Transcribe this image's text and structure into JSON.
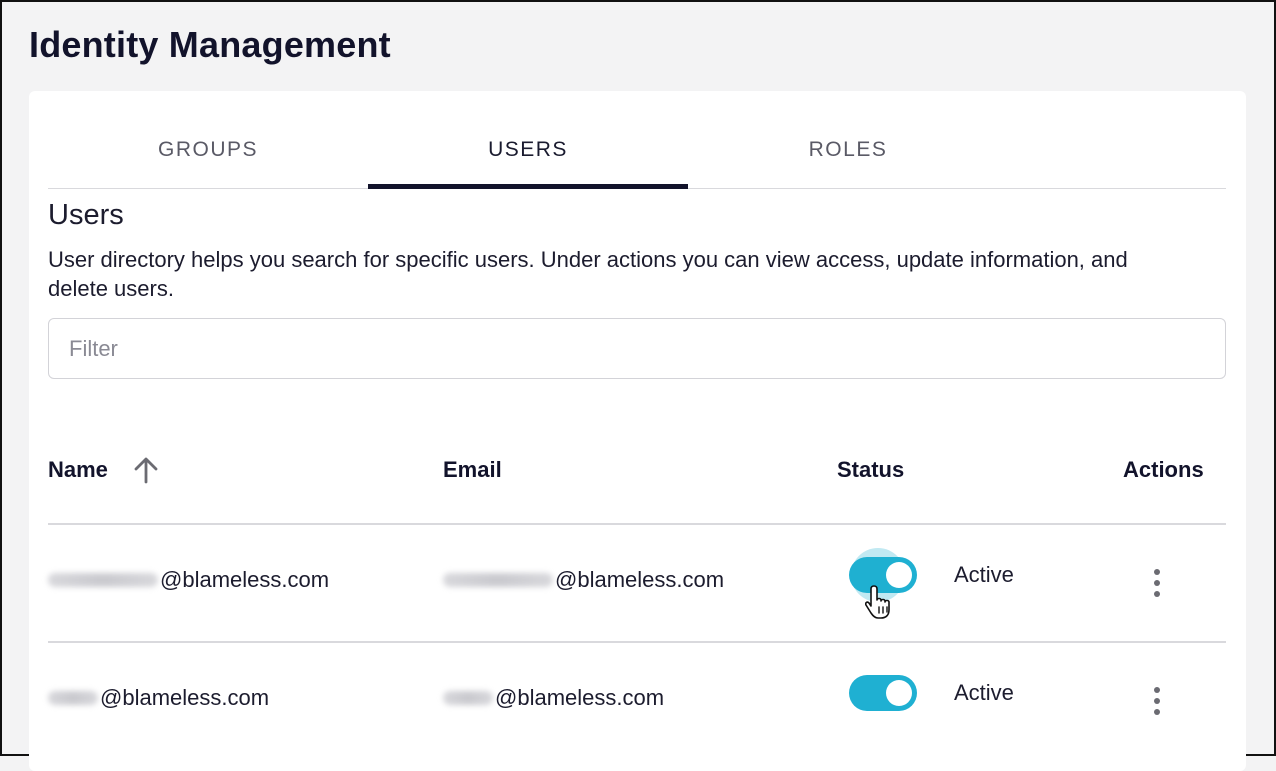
{
  "page": {
    "title": "Identity Management"
  },
  "tabs": [
    {
      "label": "GROUPS",
      "active": false
    },
    {
      "label": "USERS",
      "active": true
    },
    {
      "label": "ROLES",
      "active": false
    }
  ],
  "section": {
    "title": "Users",
    "description": "User directory helps you search for specific users. Under actions you can view access, update information, and delete users."
  },
  "filter": {
    "placeholder": "Filter",
    "value": ""
  },
  "table": {
    "columns": {
      "name": "Name",
      "email": "Email",
      "status": "Status",
      "actions": "Actions"
    },
    "sort": {
      "column": "Name",
      "direction": "ascending",
      "icon": "arrow-up-icon"
    },
    "rows": [
      {
        "name_domain": "@blameless.com",
        "email_domain": "@blameless.com",
        "status": "Active",
        "enabled": true
      },
      {
        "name_domain": "@blameless.com",
        "email_domain": "@blameless.com",
        "status": "Active",
        "enabled": true
      }
    ]
  },
  "colors": {
    "accent": "#1fb0d2",
    "tab_indicator": "#12132b",
    "background": "#f3f3f4"
  },
  "icons": {
    "sort": "arrow-up-icon",
    "actions": "more-vertical-icon",
    "cursor": "hand-pointer-icon"
  }
}
